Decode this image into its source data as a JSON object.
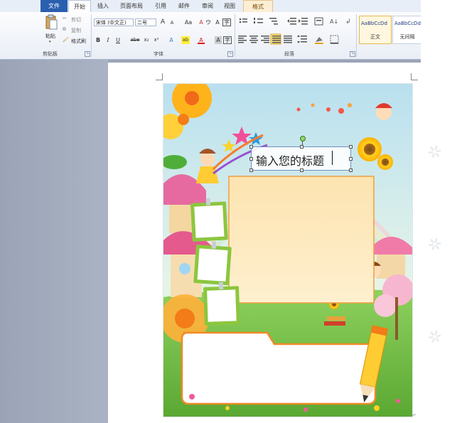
{
  "ribbon_tabs": {
    "file": "文件",
    "home": "开始",
    "insert": "插入",
    "layout": "页面布局",
    "references": "引用",
    "mailings": "邮件",
    "review": "审阅",
    "view": "视图",
    "format": "格式"
  },
  "clipboard": {
    "paste": "粘贴",
    "cut": "剪切",
    "copy": "复制",
    "format_painter": "格式刷",
    "group_label": "剪贴板"
  },
  "font": {
    "font_name": "宋体 (中文正)",
    "font_size": "二号",
    "group_label": "字体",
    "grow": "A",
    "shrink": "A",
    "change_case": "Aa",
    "clear": "A",
    "phonetic": "ウ",
    "char_border": "A",
    "bold": "B",
    "italic": "I",
    "underline": "U",
    "strike": "abe",
    "subscript": "x₂",
    "superscript": "x²",
    "text_effect": "A",
    "highlight": "ab",
    "font_color": "A",
    "char_shading": "A",
    "enclose": "字"
  },
  "paragraph": {
    "group_label": "段落"
  },
  "styles": {
    "normal_sample": "AaBbCcDd",
    "normal_name": "正文",
    "nospacing_sample": "AaBbCcDd",
    "nospacing_name": "无间隔"
  },
  "document": {
    "title_text": "输入您的标题"
  },
  "colors": {
    "file_tab": "#2a5fb0",
    "doc_bg": "#9aa4b6",
    "poster_sky": "#cfe7f3",
    "content_panel": "#fde8b8",
    "panel_border": "#f08a24",
    "grass": "#6cbf3f"
  },
  "icons": [
    "paste-icon",
    "cut-icon",
    "copy-icon",
    "format-painter-icon",
    "bullets-icon",
    "numbering-icon",
    "multilevel-icon",
    "decrease-indent-icon",
    "increase-indent-icon",
    "chinese-layout-icon",
    "sort-icon",
    "show-marks-icon",
    "align-left-icon",
    "align-center-icon",
    "align-right-icon",
    "justify-icon",
    "distribute-icon",
    "line-spacing-icon",
    "shading-icon",
    "border-icon"
  ]
}
